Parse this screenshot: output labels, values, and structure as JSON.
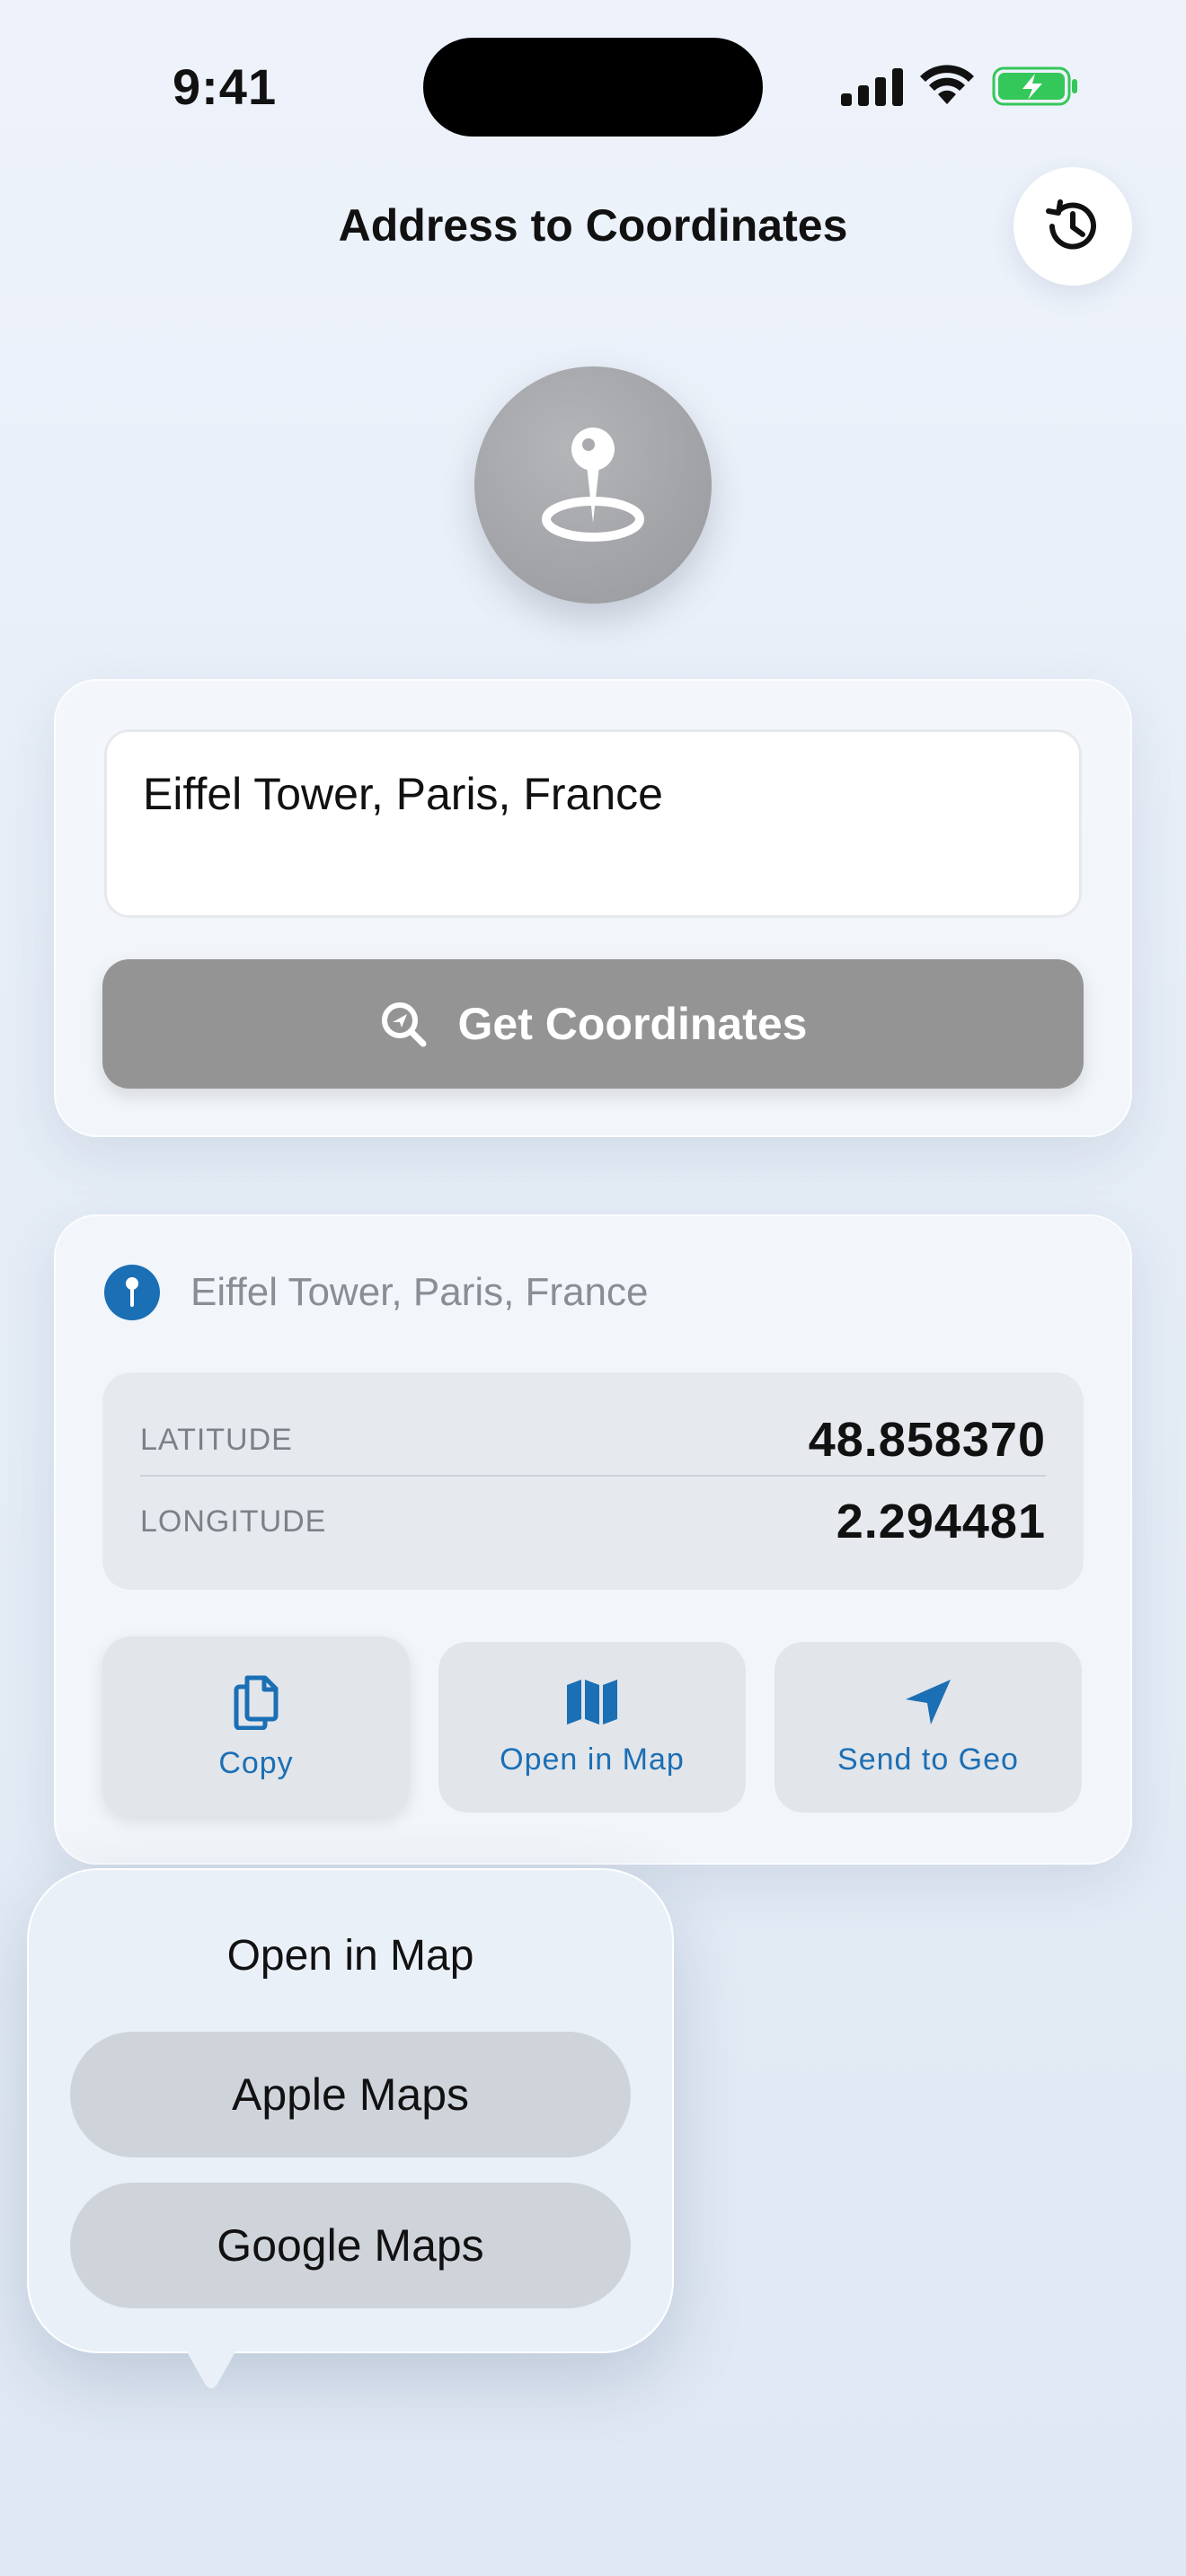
{
  "status_bar": {
    "time": "9:41"
  },
  "header": {
    "title": "Address to Coordinates",
    "history_icon": "history-clock-icon"
  },
  "hero": {
    "icon": "map-pin-icon",
    "color": "#a5a7ab"
  },
  "input_card": {
    "address_value": "Eiffel Tower, Paris, France",
    "button_label": "Get Coordinates",
    "button_icon": "search-location-icon"
  },
  "result_card": {
    "address": "Eiffel Tower, Paris, France",
    "latitude_label": "LATITUDE",
    "latitude_value": "48.858370",
    "longitude_label": "LONGITUDE",
    "longitude_value": "2.294481",
    "actions": [
      {
        "label": "Copy",
        "icon": "copy-icon"
      },
      {
        "label": "Open in Map",
        "icon": "map-icon"
      },
      {
        "label": "Send to Geo",
        "icon": "location-arrow-icon"
      }
    ]
  },
  "popover": {
    "title": "Open in Map",
    "options": [
      "Apple Maps",
      "Google Maps"
    ]
  },
  "colors": {
    "accent": "#1b6fb5",
    "button_gray": "#949494",
    "battery_green": "#34c759"
  }
}
